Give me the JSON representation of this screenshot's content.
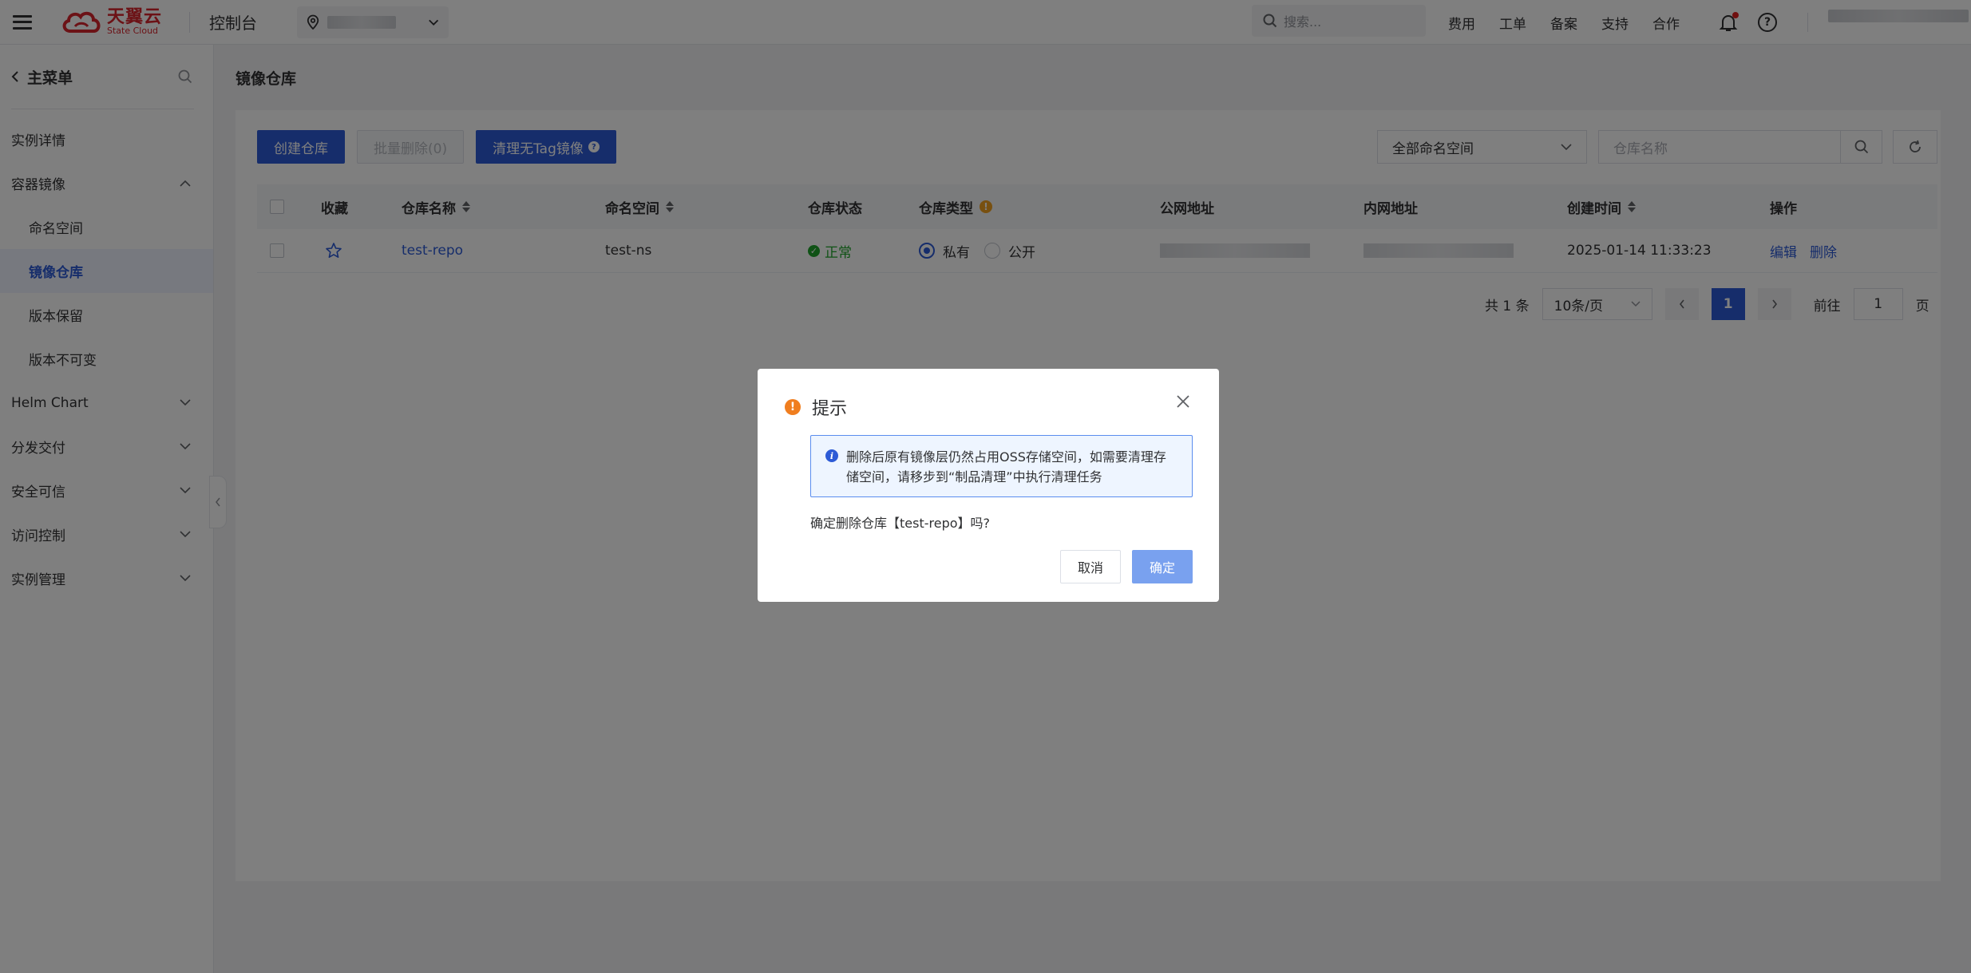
{
  "header": {
    "logo_cn": "天翼云",
    "logo_en": "State Cloud",
    "console": "控制台",
    "search_placeholder": "搜索...",
    "links": [
      "费用",
      "工单",
      "备案",
      "支持",
      "合作"
    ]
  },
  "sidebar": {
    "title": "主菜单",
    "items": [
      {
        "label": "实例详情",
        "level": 0
      },
      {
        "label": "容器镜像",
        "level": 0,
        "expanded": true
      },
      {
        "label": "命名空间",
        "level": 1
      },
      {
        "label": "镜像仓库",
        "level": 1,
        "active": true
      },
      {
        "label": "版本保留",
        "level": 1
      },
      {
        "label": "版本不可变",
        "level": 1
      },
      {
        "label": "Helm Chart",
        "level": 0
      },
      {
        "label": "分发交付",
        "level": 0
      },
      {
        "label": "安全可信",
        "level": 0
      },
      {
        "label": "访问控制",
        "level": 0
      },
      {
        "label": "实例管理",
        "level": 0
      }
    ]
  },
  "page": {
    "title": "镜像仓库",
    "toolbar": {
      "create": "创建仓库",
      "batch_delete": "批量删除(0)",
      "clean_untagged": "清理无Tag镜像"
    },
    "namespace_select": "全部命名空间",
    "repo_search_placeholder": "仓库名称"
  },
  "table": {
    "columns": [
      "收藏",
      "仓库名称",
      "命名空间",
      "仓库状态",
      "仓库类型",
      "公网地址",
      "内网地址",
      "创建时间",
      "操作"
    ],
    "rows": [
      {
        "name": "test-repo",
        "namespace": "test-ns",
        "status": "正常",
        "type_private": "私有",
        "type_public": "公开",
        "created": "2025-01-14 11:33:23",
        "action_edit": "编辑",
        "action_delete": "删除"
      }
    ]
  },
  "pagination": {
    "total": "共 1 条",
    "page_size": "10条/页",
    "current": "1",
    "goto_label": "前往",
    "goto_value": "1",
    "page_unit": "页"
  },
  "dialog": {
    "title": "提示",
    "info": "删除后原有镜像层仍然占用OSS存储空间，如需要清理存储空间，请移步到“制品清理”中执行清理任务",
    "message": "确定删除仓库【test-repo】吗?",
    "cancel": "取消",
    "confirm": "确定"
  },
  "colors": {
    "primary": "#2d5bd6",
    "brand_red": "#d8242c",
    "success": "#1ea52a",
    "warning": "#f07e1f"
  }
}
